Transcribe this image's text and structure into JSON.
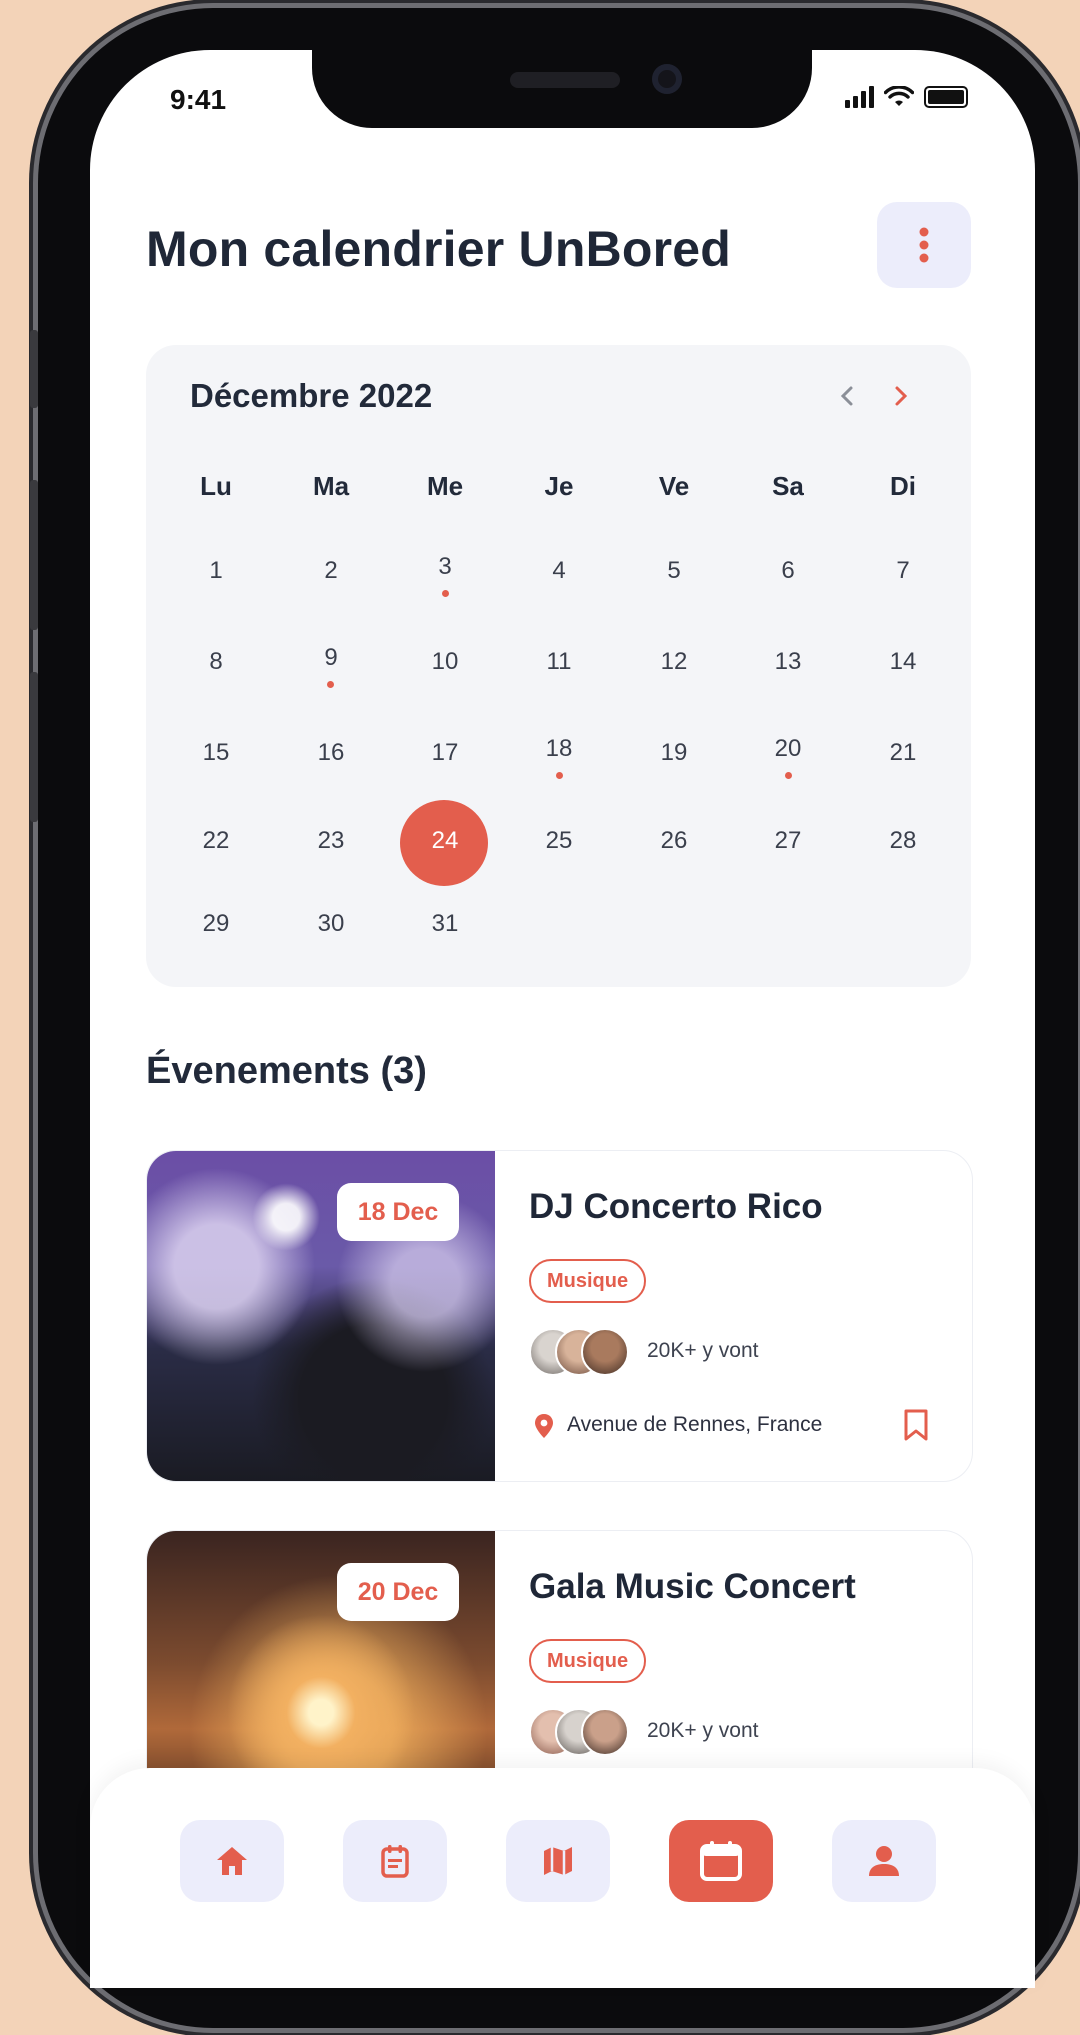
{
  "status_bar": {
    "time": "9:41"
  },
  "header": {
    "title": "Mon calendrier UnBored"
  },
  "calendar": {
    "month": "Décembre 2022",
    "weekdays": [
      "Lu",
      "Ma",
      "Me",
      "Je",
      "Ve",
      "Sa",
      "Di"
    ],
    "weeks": [
      [
        "1",
        "2",
        "3",
        "4",
        "5",
        "6",
        "7"
      ],
      [
        "8",
        "9",
        "10",
        "11",
        "12",
        "13",
        "14"
      ],
      [
        "15",
        "16",
        "17",
        "18",
        "19",
        "20",
        "21"
      ],
      [
        "22",
        "23",
        "24",
        "25",
        "26",
        "27",
        "28"
      ],
      [
        "29",
        "30",
        "31"
      ]
    ],
    "selected_day": "24",
    "event_days": [
      "3",
      "9",
      "18",
      "20"
    ]
  },
  "events_section": {
    "title": "Évenements (3)"
  },
  "events": [
    {
      "date": "18 Dec",
      "name": "DJ Concerto Rico",
      "tag": "Musique",
      "going": "20K+ y vont",
      "location": "Avenue de Rennes, France"
    },
    {
      "date": "20 Dec",
      "name": "Gala Music Concert",
      "tag": "Musique",
      "going": "20K+ y vont"
    }
  ],
  "nav": {
    "items": [
      "home-icon",
      "agenda-icon",
      "map-icon",
      "calendar-icon",
      "profile-icon"
    ],
    "active": "calendar-icon"
  },
  "colors": {
    "accent": "#e35e4d",
    "soft": "#ecedfb",
    "card": "#f4f5f8",
    "text": "#1f2737"
  }
}
